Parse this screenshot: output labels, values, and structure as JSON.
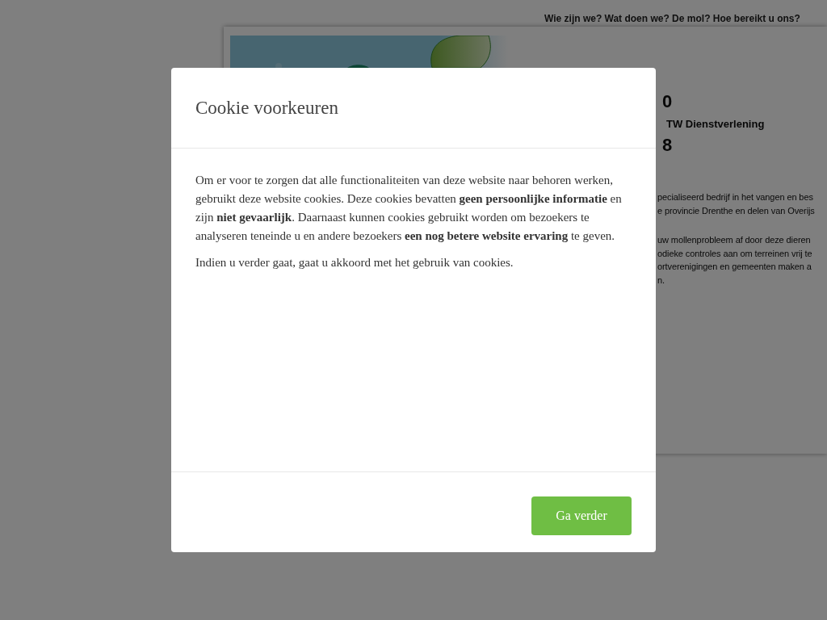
{
  "nav": {
    "text": "Wie zijn we? Wat doen we? De mol? Hoe bereikt u ons?"
  },
  "background": {
    "texts": [
      {
        "kind": "big",
        "text": "0"
      },
      {
        "kind": "sub",
        "text": "TW Dienstverlening"
      },
      {
        "kind": "big",
        "text": "8"
      },
      {
        "kind": "line",
        "text": "pecialiseerd bedrijf in het vangen en bes"
      },
      {
        "kind": "line",
        "text": "e provincie Drenthe en delen van Overijs"
      },
      {
        "kind": "gap",
        "text": "uw mollenprobleem af door deze dieren"
      },
      {
        "kind": "line",
        "text": "odieke controles aan om terreinen vrij te"
      },
      {
        "kind": "line",
        "text": "ortverenigingen en gemeenten maken a"
      },
      {
        "kind": "line",
        "text": "n."
      }
    ]
  },
  "modal": {
    "title": "Cookie voorkeuren",
    "paragraphs": [
      "Om er voor te zorgen dat alle functionaliteiten van deze website naar behoren werken, gebruikt deze website cookies. Deze cookies bevatten **geen persoonlijke informatie** en zijn **niet gevaarlijk**. Daarnaast kunnen cookies gebruikt worden om bezoekers te analyseren teneinde u en andere bezoekers **een nog betere website ervaring** te geven.",
      "Indien u verder gaat, gaat u akkoord met het gebruik van cookies."
    ],
    "button": "Ga verder"
  }
}
